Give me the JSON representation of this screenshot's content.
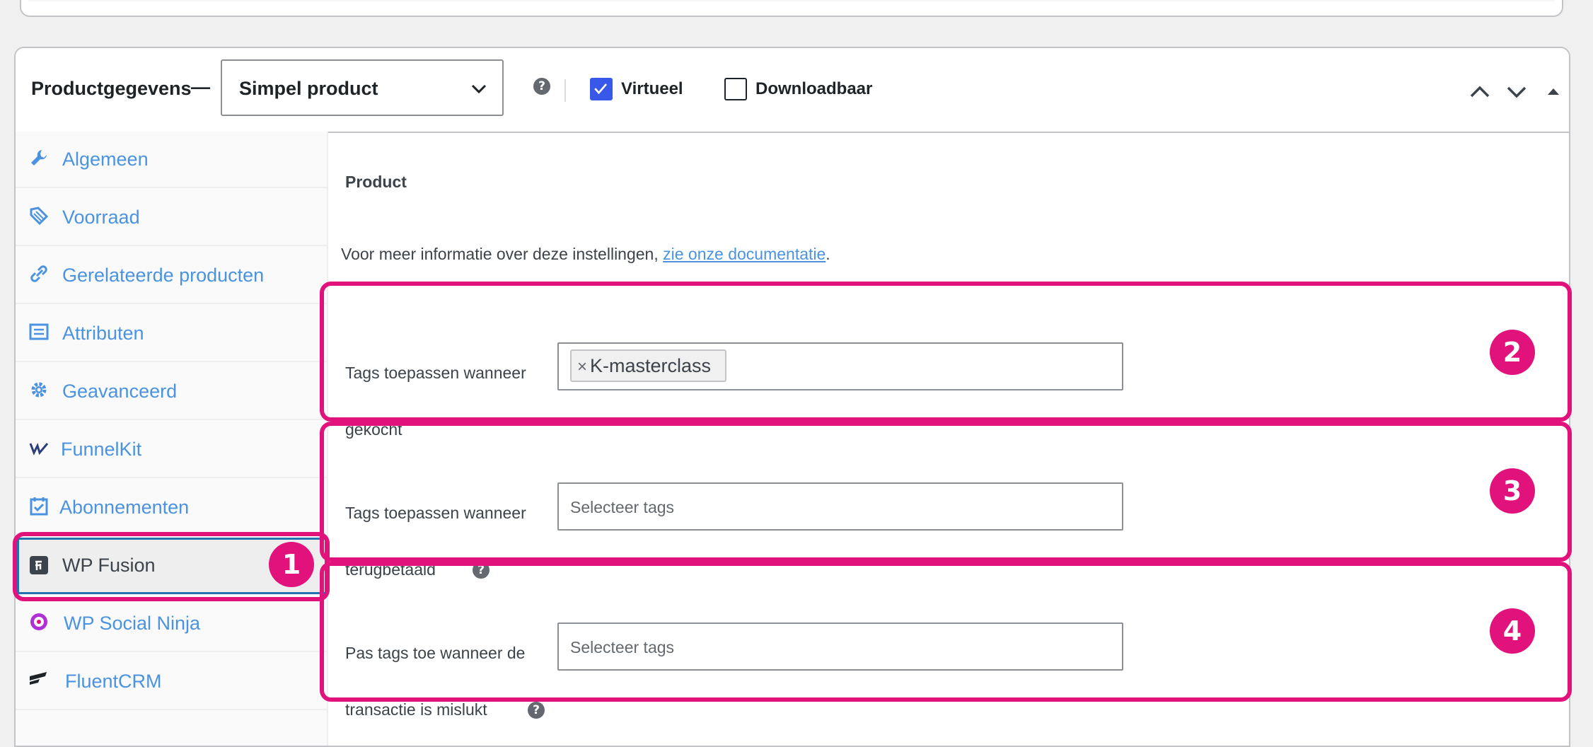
{
  "metabox": {
    "title": "Productgegevens",
    "dash": "—",
    "product_type": {
      "selected": "Simpel product"
    },
    "help_glyph": "?",
    "virtual": {
      "label": "Virtueel",
      "checked": true
    },
    "downloadable": {
      "label": "Downloadbaar",
      "checked": false
    }
  },
  "sidebar": {
    "items": [
      {
        "label": "Algemeen",
        "icon": "wrench-icon"
      },
      {
        "label": "Voorraad",
        "icon": "tag-icon"
      },
      {
        "label": "Gerelateerde producten",
        "icon": "link-icon"
      },
      {
        "label": "Attributen",
        "icon": "list-icon"
      },
      {
        "label": "Geavanceerd",
        "icon": "gear-icon"
      },
      {
        "label": "FunnelKit",
        "icon": "funnelkit-icon"
      },
      {
        "label": "Abonnementen",
        "icon": "calendar-check-icon"
      },
      {
        "label": "WP Fusion",
        "icon": "wp-fusion-icon",
        "active": true
      },
      {
        "label": "WP Social Ninja",
        "icon": "wp-social-ninja-icon"
      },
      {
        "label": "FluentCRM",
        "icon": "fluentcrm-icon"
      }
    ]
  },
  "content": {
    "section_title": "Product",
    "info_text": "Voor meer informatie over deze instellingen, ",
    "info_link": "zie onze documentatie",
    "info_end": ".",
    "fields": [
      {
        "label_line1": "Tags toepassen wanneer",
        "label_line2": "gekocht",
        "tags": [
          "K-masterclass"
        ],
        "placeholder": ""
      },
      {
        "label_line1": "Tags toepassen wanneer",
        "label_line2": "terugbetaald",
        "tags": [],
        "placeholder": "Selecteer tags"
      },
      {
        "label_line1": "Pas tags toe wanneer de",
        "label_line2": "transactie is mislukt",
        "tags": [],
        "placeholder": "Selecteer tags"
      }
    ],
    "chip_remove": "×"
  },
  "annotations": {
    "color": "#e1127c",
    "badges": [
      "1",
      "2",
      "3",
      "4"
    ]
  }
}
